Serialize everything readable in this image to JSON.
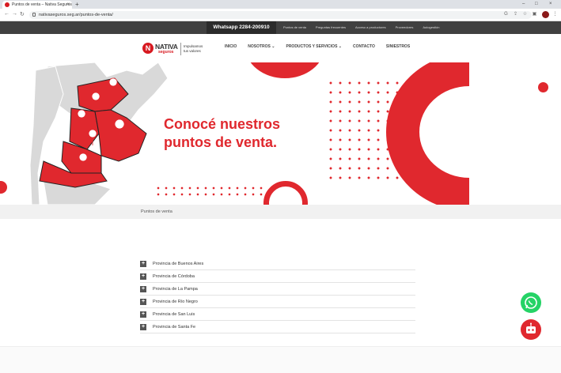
{
  "browser": {
    "tab_title": "Puntos de venta – Nativa Seguros",
    "tab_close": "×",
    "new_tab": "+",
    "window_controls": [
      "–",
      "□",
      "×"
    ],
    "url": "nativaseguros.seg.ar/puntos-de-venta/",
    "nav": [
      "←",
      "→",
      "↻"
    ],
    "extensions": [
      "G",
      "⇪",
      "☆",
      "▣",
      "⋮"
    ]
  },
  "topbar": {
    "whatsapp": "Whatsapp 2284-200910",
    "links": [
      "Puntos de venta",
      "Preguntas frecuentes",
      "Acceso a productores",
      "Proveedores",
      "Autogestión"
    ]
  },
  "brand": {
    "mark": "N",
    "name": "NATIVA",
    "sub": "seguros",
    "tagline": "Impulsamos tus valores"
  },
  "nav": {
    "items": [
      "INICIO",
      "NOSOTROS ⌄",
      "PRODUCTOS Y SERVICIOS ⌄",
      "CONTACTO",
      "SINIESTROS"
    ]
  },
  "hero": {
    "title_line1": "Conocé nuestros",
    "title_line2": "puntos de venta."
  },
  "breadcrumb": "Puntos de venta",
  "accordion": {
    "icon": "+",
    "items": [
      "Provincia de Buenos Aires",
      "Provincia de Córdoba",
      "Provincia de La Pampa",
      "Provincia de Río Negro",
      "Provincia de San Luis",
      "Provincia de Santa Fe"
    ]
  },
  "colors": {
    "brand_red": "#e0282e",
    "dark_bar": "#404040",
    "whatsapp_green": "#25d366"
  }
}
